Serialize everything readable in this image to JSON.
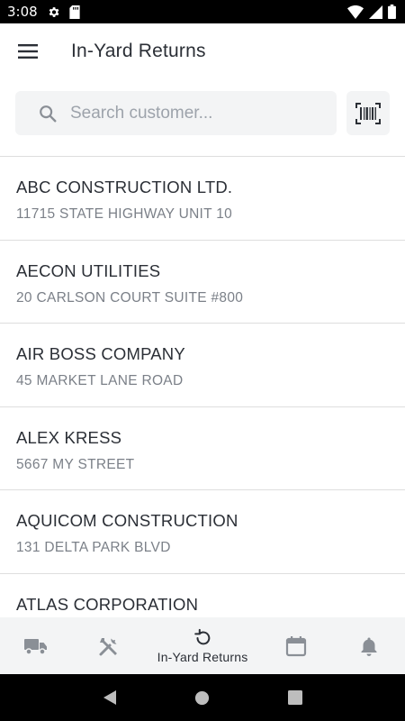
{
  "status_bar": {
    "time": "3:08",
    "icons": [
      "settings-icon",
      "sd-card-icon",
      "wifi-icon",
      "signal-icon",
      "battery-icon"
    ]
  },
  "app_bar": {
    "title": "In-Yard Returns",
    "menu_icon": "hamburger-menu-icon"
  },
  "search": {
    "placeholder": "Search customer...",
    "value": "",
    "search_icon": "search-icon",
    "scan_icon": "barcode-scan-icon"
  },
  "customers": [
    {
      "name": "ABC CONSTRUCTION LTD.",
      "address": "11715 STATE HIGHWAY UNIT 10"
    },
    {
      "name": "AECON UTILITIES",
      "address": "20 CARLSON COURT SUITE #800"
    },
    {
      "name": "AIR BOSS COMPANY",
      "address": "45 MARKET LANE ROAD"
    },
    {
      "name": "ALEX KRESS",
      "address": "5667 MY STREET"
    },
    {
      "name": "AQUICOM CONSTRUCTION",
      "address": "131 DELTA PARK BLVD"
    },
    {
      "name": "ATLAS CORPORATION",
      "address": ""
    }
  ],
  "bottom_nav": {
    "items": [
      {
        "icon": "truck-icon",
        "label": ""
      },
      {
        "icon": "tools-icon",
        "label": ""
      },
      {
        "icon": "return-icon",
        "label": "In-Yard Returns",
        "active": true
      },
      {
        "icon": "calendar-icon",
        "label": ""
      },
      {
        "icon": "bell-icon",
        "label": ""
      }
    ]
  },
  "colors": {
    "text_primary": "#2b2f36",
    "text_secondary": "#7b8088",
    "icon_gray": "#8a8f96",
    "surface": "#f3f4f5",
    "divider": "#dedede"
  }
}
